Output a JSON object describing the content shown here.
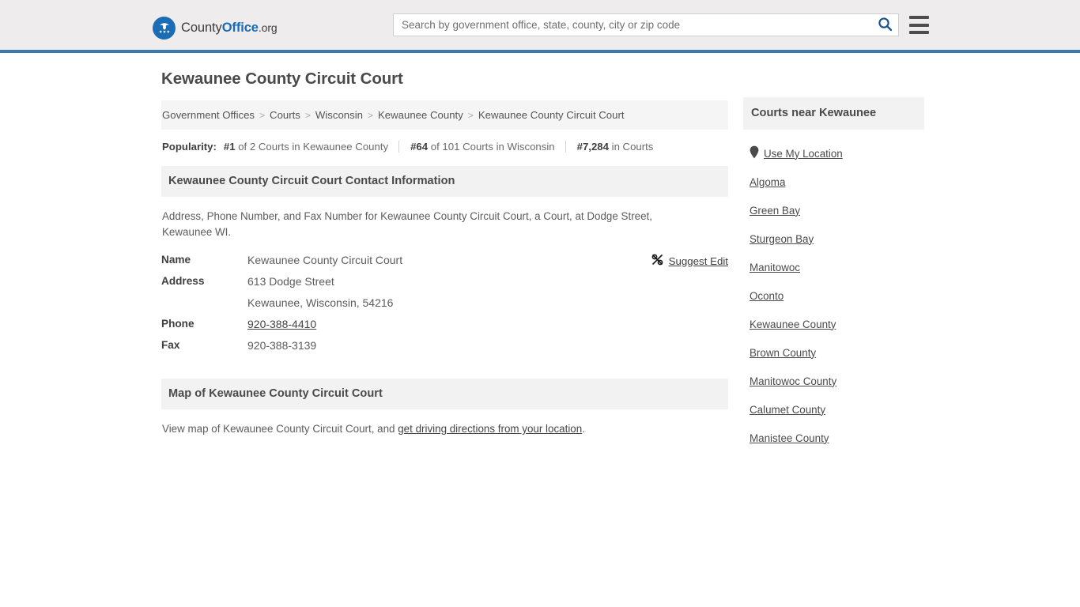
{
  "header": {
    "logo": {
      "icon": "eagle-shield-logo-icon",
      "text_county": "County",
      "text_office": "Office",
      "text_org": ".org"
    },
    "search": {
      "placeholder": "Search by government office, state, county, city or zip code",
      "value": "",
      "search_icon": "search-icon"
    },
    "menu_icon": "hamburger-menu-icon",
    "background_color": "#eeeced",
    "accent_color": "#3a79ad"
  },
  "main": {
    "page_title": "Kewaunee County Circuit Court",
    "breadcrumb": {
      "separator": ">",
      "items": [
        {
          "label": "Government Offices",
          "current": false
        },
        {
          "label": "Courts",
          "current": false
        },
        {
          "label": "Wisconsin",
          "current": false
        },
        {
          "label": "Kewaunee County",
          "current": false
        },
        {
          "label": "Kewaunee County Circuit Court",
          "current": true
        }
      ]
    },
    "popularity": {
      "label": "Popularity:",
      "items": [
        {
          "rank": "#1",
          "rest": " of 2 Courts in Kewaunee County"
        },
        {
          "rank": "#64",
          "rest": " of 101 Courts in Wisconsin"
        },
        {
          "rank": "#7,284",
          "rest": " in Courts"
        }
      ]
    },
    "contact_section": {
      "heading": "Kewaunee County Circuit Court Contact Information",
      "description": "Address, Phone Number, and Fax Number for Kewaunee County Circuit Court, a Court, at Dodge Street, Kewaunee WI.",
      "suggest_edit": {
        "label": "Suggest Edit",
        "icon": "edit-pencil-icon"
      },
      "rows": [
        {
          "label": "Name",
          "value": "Kewaunee County Circuit Court",
          "link": false
        },
        {
          "label": "Address",
          "value": "613 Dodge Street",
          "link": false
        },
        {
          "label": "",
          "value": "Kewaunee, Wisconsin, 54216",
          "link": false
        },
        {
          "label": "Phone",
          "value": "920-388-4410",
          "link": true
        },
        {
          "label": "Fax",
          "value": "920-388-3139",
          "link": false
        }
      ]
    },
    "map_section": {
      "heading": "Map of Kewaunee County Circuit Court",
      "description_prefix": "View map of Kewaunee County Circuit Court, and ",
      "description_link": "get driving directions from your location",
      "description_suffix": "."
    }
  },
  "sidebar": {
    "heading": "Courts near Kewaunee",
    "items": [
      {
        "label": "Use My Location",
        "icon": "map-pin-icon"
      },
      {
        "label": "Algoma",
        "icon": ""
      },
      {
        "label": "Green Bay",
        "icon": ""
      },
      {
        "label": "Sturgeon Bay",
        "icon": ""
      },
      {
        "label": "Manitowoc",
        "icon": ""
      },
      {
        "label": "Oconto",
        "icon": ""
      },
      {
        "label": "Kewaunee County",
        "icon": ""
      },
      {
        "label": "Brown County",
        "icon": ""
      },
      {
        "label": "Manitowoc County",
        "icon": ""
      },
      {
        "label": "Calumet County",
        "icon": ""
      },
      {
        "label": "Manistee County",
        "icon": ""
      }
    ]
  }
}
